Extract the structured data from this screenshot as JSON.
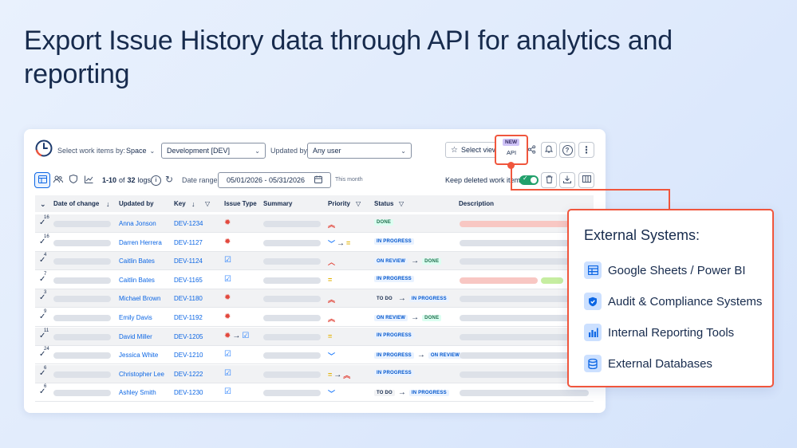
{
  "headline": "Export Issue History data through API for analytics and reporting",
  "toolbar": {
    "select_label": "Select work items by:",
    "space_value": "Space",
    "project_value": "Development [DEV]",
    "updated_by_label": "Updated by:",
    "updated_by_value": "Any user",
    "select_view_label": "Select view",
    "new_badge": "NEW",
    "api_label": "API"
  },
  "subbar": {
    "logs_count": "1-10",
    "logs_of": "of",
    "logs_total": "32",
    "logs_suffix": "logs",
    "date_range_label": "Date range:",
    "date_range_value": "05/01/2026 - 05/31/2026",
    "date_hint": "This month",
    "keep_deleted_label": "Keep deleted work items"
  },
  "table": {
    "columns": [
      "Date of change",
      "Updated by",
      "Key",
      "Issue Type",
      "Summary",
      "Priority",
      "Status",
      "Description"
    ],
    "rows": [
      {
        "count": "16",
        "user": "Anna Jonson",
        "key": "DEV-1234",
        "type": [
          "bug"
        ],
        "priority": [
          {
            "glyph": "︽",
            "color": "#e2483d"
          }
        ],
        "status": [
          {
            "text": "DONE",
            "kind": "done"
          }
        ],
        "desc_colors": [
          "#f8c7c3"
        ]
      },
      {
        "count": "16",
        "user": "Darren Herrera",
        "key": "DEV-1127",
        "type": [
          "bug"
        ],
        "priority": [
          {
            "glyph": "﹀",
            "color": "#1d7afc"
          },
          {
            "glyph": "=",
            "color": "#e2b203"
          }
        ],
        "status": [
          {
            "text": "IN PROGRESS",
            "kind": "prog"
          }
        ],
        "desc_colors": [
          "#dde1e8"
        ]
      },
      {
        "count": "4",
        "user": "Caitlin Bates",
        "key": "DEV-1124",
        "type": [
          "task"
        ],
        "priority": [
          {
            "glyph": "︿",
            "color": "#e2483d"
          }
        ],
        "status": [
          {
            "text": "ON REVIEW",
            "kind": "rev"
          },
          {
            "text": "DONE",
            "kind": "done"
          }
        ],
        "desc_colors": [
          "#dde1e8"
        ]
      },
      {
        "count": "7",
        "user": "Caitlin Bates",
        "key": "DEV-1165",
        "type": [
          "task"
        ],
        "priority": [
          {
            "glyph": "=",
            "color": "#e2b203"
          }
        ],
        "status": [
          {
            "text": "IN PROGRESS",
            "kind": "prog"
          }
        ],
        "desc_colors": [
          "#f8c7c3",
          "#c6eda1"
        ]
      },
      {
        "count": "3",
        "user": "Michael Brown",
        "key": "DEV-1180",
        "type": [
          "bug"
        ],
        "priority": [
          {
            "glyph": "︽",
            "color": "#e2483d"
          }
        ],
        "status": [
          {
            "text": "TO DO",
            "kind": "todo"
          },
          {
            "text": "IN PROGRESS",
            "kind": "prog"
          }
        ],
        "desc_colors": [
          "#dde1e8"
        ]
      },
      {
        "count": "9",
        "user": "Emily Davis",
        "key": "DEV-1192",
        "type": [
          "bug"
        ],
        "priority": [
          {
            "glyph": "︽",
            "color": "#e2483d"
          }
        ],
        "status": [
          {
            "text": "ON REVIEW",
            "kind": "rev"
          },
          {
            "text": "DONE",
            "kind": "done"
          }
        ],
        "desc_colors": [
          "#dde1e8"
        ]
      },
      {
        "count": "11",
        "user": "David Miller",
        "key": "DEV-1205",
        "type": [
          "bug",
          "task"
        ],
        "priority": [
          {
            "glyph": "=",
            "color": "#e2b203"
          }
        ],
        "status": [
          {
            "text": "IN PROGRESS",
            "kind": "prog"
          }
        ],
        "desc_colors": [
          "#dde1e8"
        ]
      },
      {
        "count": "24",
        "user": "Jessica White",
        "key": "DEV-1210",
        "type": [
          "task"
        ],
        "priority": [
          {
            "glyph": "﹀",
            "color": "#1d7afc"
          }
        ],
        "status": [
          {
            "text": "IN PROGRESS",
            "kind": "prog"
          },
          {
            "text": "ON REVIEW",
            "kind": "rev"
          }
        ],
        "desc_colors": [
          "#dde1e8"
        ]
      },
      {
        "count": "6",
        "user": "Christopher Lee",
        "key": "DEV-1222",
        "type": [
          "task"
        ],
        "priority": [
          {
            "glyph": "=",
            "color": "#e2b203"
          },
          {
            "glyph": "︽",
            "color": "#e2483d"
          }
        ],
        "status": [
          {
            "text": "IN PROGRESS",
            "kind": "prog"
          }
        ],
        "desc_colors": [
          "#dde1e8"
        ]
      },
      {
        "count": "6",
        "user": "Ashley Smith",
        "key": "DEV-1230",
        "type": [
          "task"
        ],
        "priority": [
          {
            "glyph": "﹀",
            "color": "#1d7afc"
          }
        ],
        "status": [
          {
            "text": "TO DO",
            "kind": "todo"
          },
          {
            "text": "IN PROGRESS",
            "kind": "prog"
          }
        ],
        "desc_colors": [
          "#dde1e8"
        ]
      }
    ]
  },
  "popup": {
    "title": "External Systems:",
    "items": [
      {
        "label": "Google Sheets / Power BI",
        "icon": "table-icon"
      },
      {
        "label": "Audit & Compliance Systems",
        "icon": "shield-icon"
      },
      {
        "label": "Internal Reporting Tools",
        "icon": "bar-chart-icon"
      },
      {
        "label": "External Databases",
        "icon": "database-icon"
      }
    ]
  },
  "colors": {
    "accent": "#f0563d",
    "link": "#0c66e4",
    "toggle": "#22a06b"
  }
}
